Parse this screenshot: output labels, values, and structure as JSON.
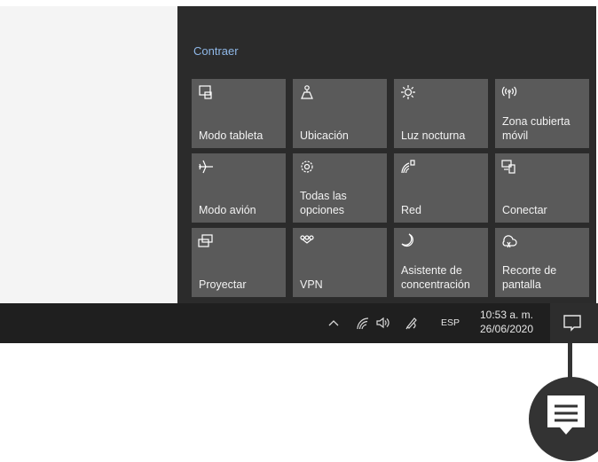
{
  "action_center": {
    "collapse_label": "Contraer",
    "tiles": [
      {
        "label": "Modo tableta",
        "icon": "tablet-mode-icon"
      },
      {
        "label": "Ubicación",
        "icon": "location-icon"
      },
      {
        "label": "Luz nocturna",
        "icon": "night-light-icon"
      },
      {
        "label": "Zona cubierta móvil",
        "icon": "mobile-hotspot-icon"
      },
      {
        "label": "Modo avión",
        "icon": "airplane-mode-icon"
      },
      {
        "label": "Todas las opciones",
        "icon": "settings-gear-icon"
      },
      {
        "label": "Red",
        "icon": "network-icon"
      },
      {
        "label": "Conectar",
        "icon": "connect-icon"
      },
      {
        "label": "Proyectar",
        "icon": "project-icon"
      },
      {
        "label": "VPN",
        "icon": "vpn-icon"
      },
      {
        "label": "Asistente de concentración",
        "icon": "focus-assist-moon-icon"
      },
      {
        "label": "Recorte de pantalla",
        "icon": "screen-snip-icon"
      }
    ]
  },
  "taskbar": {
    "tray_icons": [
      "chevron-up-icon",
      "wifi-icon",
      "volume-icon",
      "pen-icon"
    ],
    "language": "ESP",
    "time": "10:53 a. m.",
    "date": "26/06/2020",
    "notification_icon": "notification-center-icon"
  },
  "colors": {
    "panel_bg": "#2b2b2b",
    "tile_bg": "#5a5a5a",
    "link": "#8fb8e8",
    "taskbar_bg": "#1f1f1f",
    "callout": "#333333"
  }
}
